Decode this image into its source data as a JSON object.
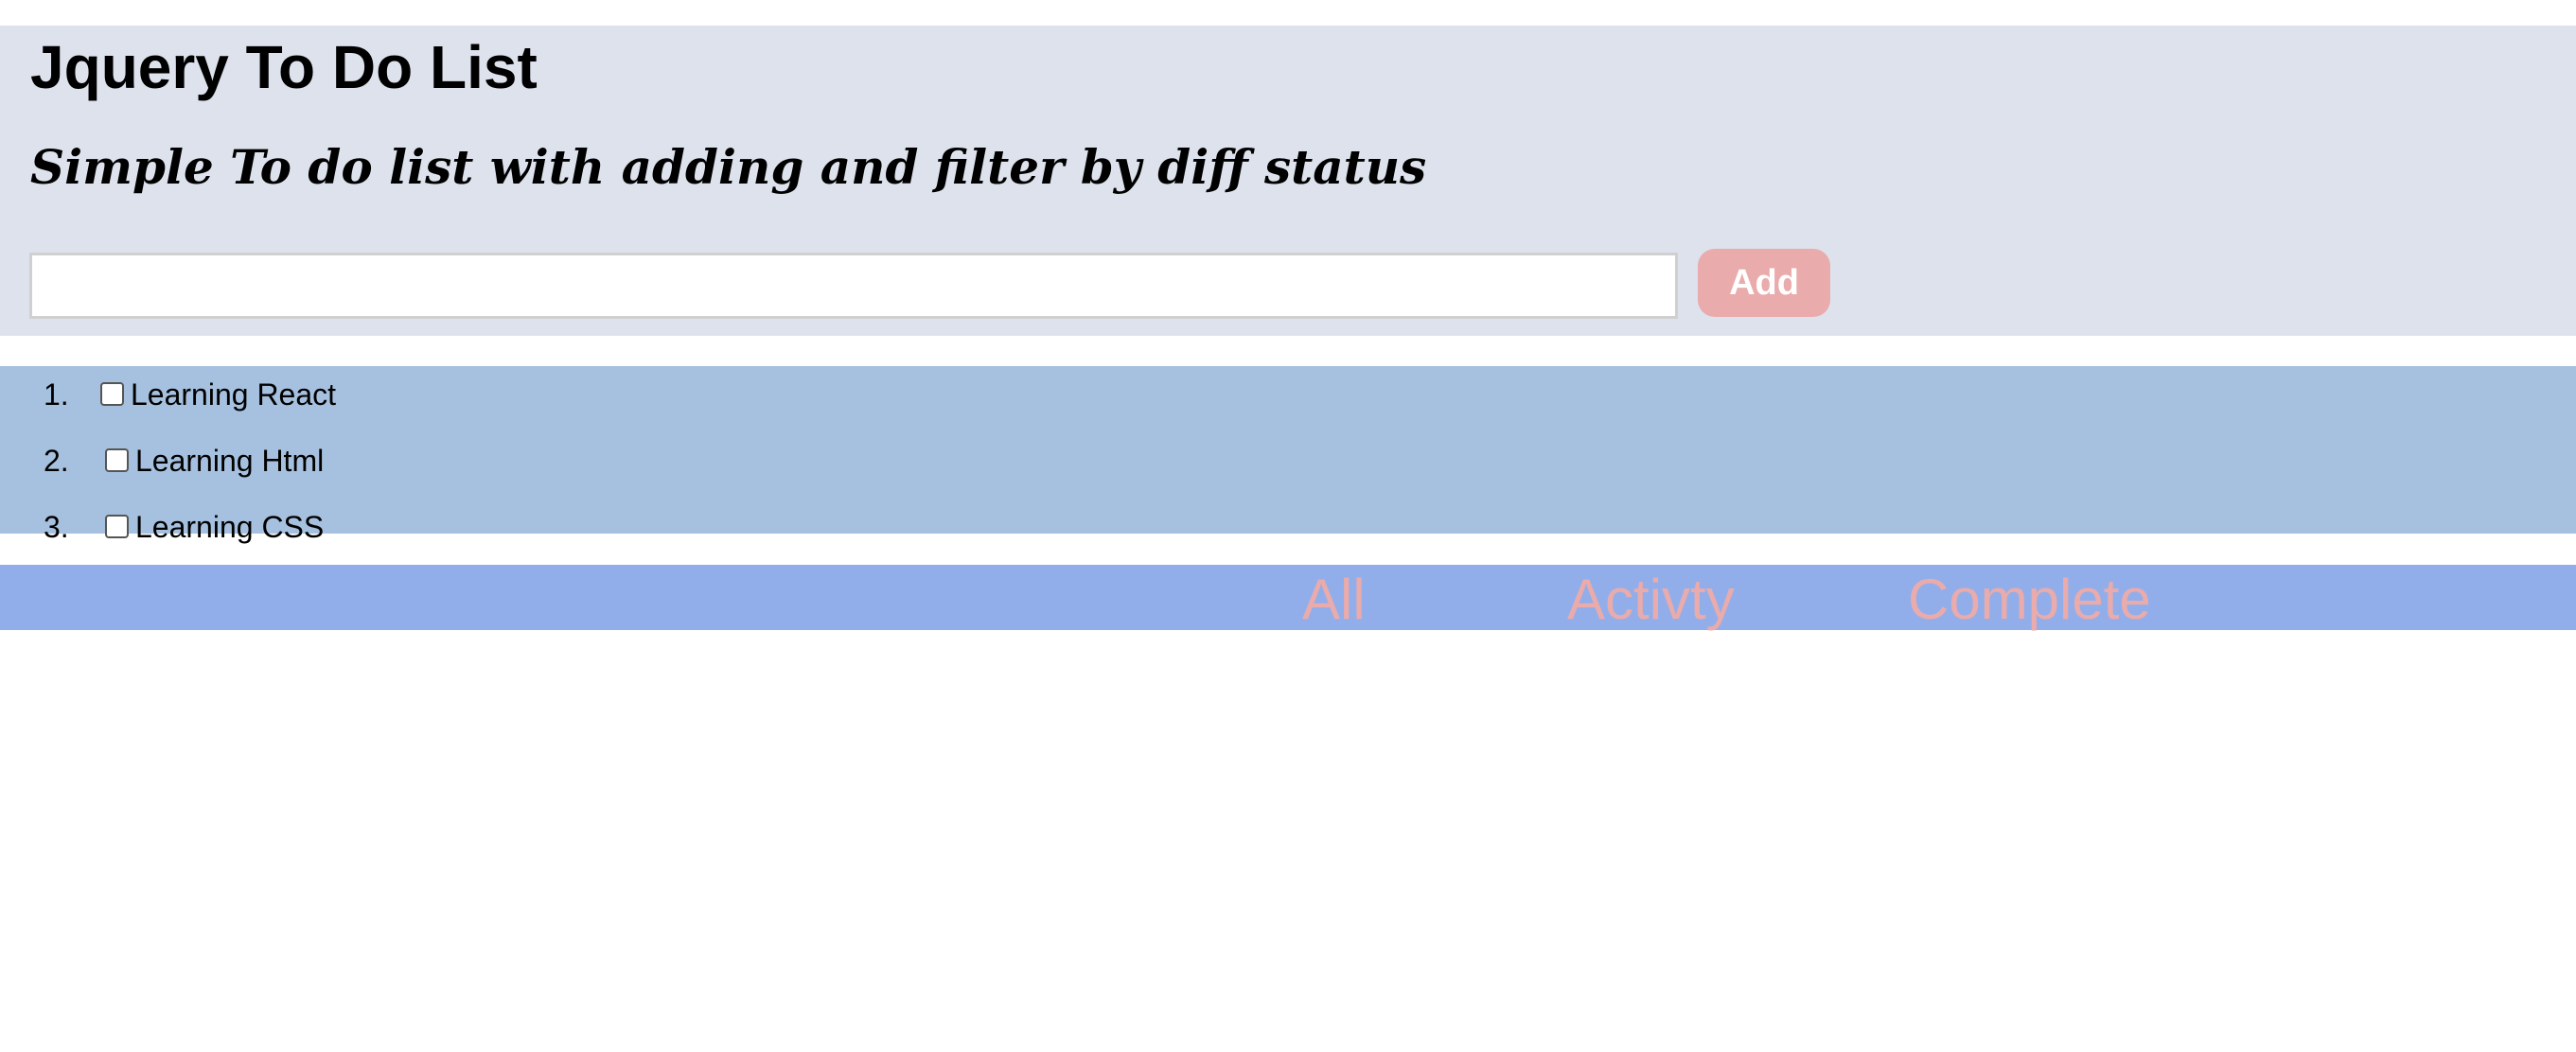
{
  "header": {
    "title": "Jquery To Do List",
    "subtitle": "Simple To do list with adding and filter by diff status",
    "input": {
      "value": "",
      "placeholder": ""
    },
    "add_label": "Add"
  },
  "todos": [
    {
      "number": "1.",
      "label": "Learning React",
      "checked": false
    },
    {
      "number": "2.",
      "label": "Learning Html",
      "checked": false
    },
    {
      "number": "3.",
      "label": "Learning CSS",
      "checked": false
    }
  ],
  "filters": [
    {
      "label": "All"
    },
    {
      "label": "Activty"
    },
    {
      "label": "Complete"
    }
  ],
  "colors": {
    "header_bg": "#dde2ec",
    "list_bg": "#a6c1df",
    "filter_bg": "#92aeea",
    "accent_pink": "#e9abab"
  }
}
